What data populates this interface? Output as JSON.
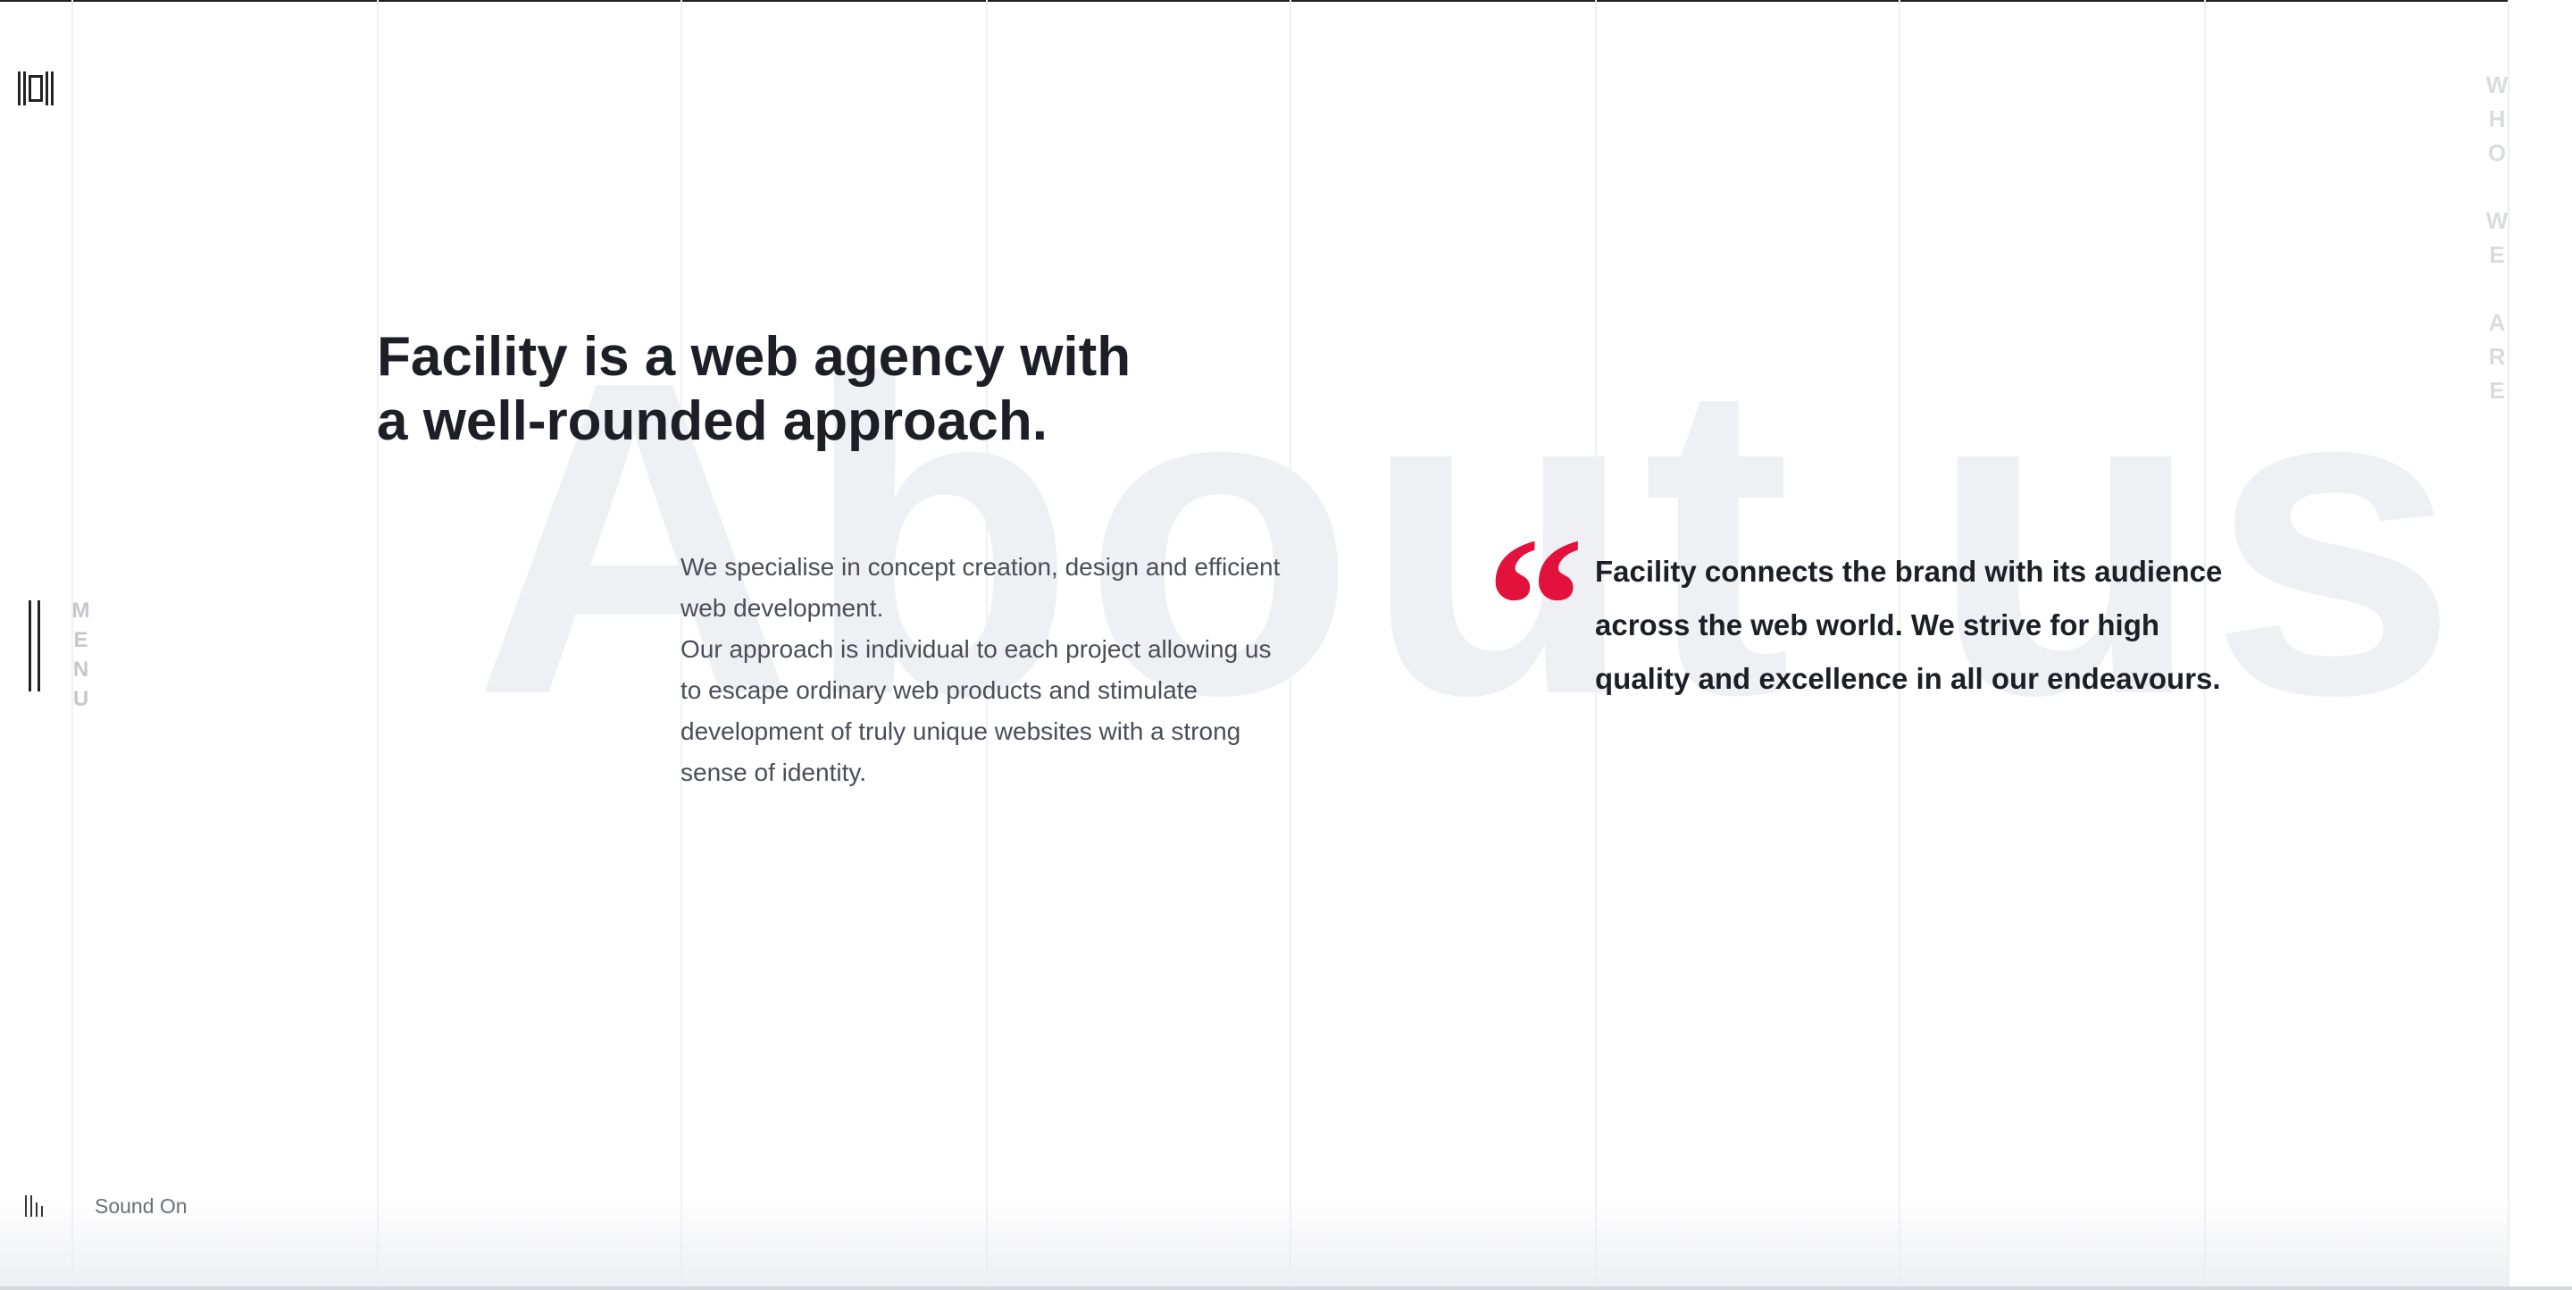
{
  "brand": {
    "logo_icon": "facility-logo-icon"
  },
  "navigation": {
    "menu_label": "MENU",
    "menu_icon": "menu-bars-icon"
  },
  "section": {
    "label": "WHO WE ARE"
  },
  "about": {
    "background_word": "About us",
    "headline_line1": "Facility is a web agency with",
    "headline_line2": "a well-rounded approach.",
    "paragraph1": "We specialise in concept creation, design and efficient web development.",
    "paragraph2": "Our approach is individual to each project allowing us to escape ordinary web products and stimulate development of truly unique websites with a strong sense of identity.",
    "quote_mark": "“",
    "quote_text": "Facility connects the brand with its audience across the web world. We strive for high quality and excellence in all our endeavours."
  },
  "sound": {
    "label": "Sound On",
    "icon": "sound-bars-icon"
  },
  "colors": {
    "accent": "#e3123d",
    "text_dark": "#1d1f26",
    "text_body": "#4b4e58",
    "background_word": "#eff0f4",
    "grid_line": "#f0f1f4"
  }
}
